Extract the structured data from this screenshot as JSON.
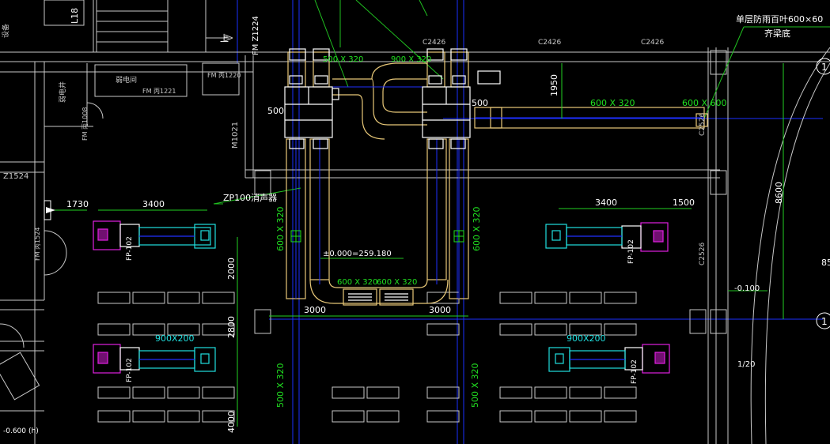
{
  "colors": {
    "background": "#000000",
    "wall": "#c8c8c8",
    "duct": "#e8c878",
    "duct_center": "#2030ff",
    "dim": "#22d022",
    "leader": "#20c020",
    "cyan": "#20e0e0",
    "magenta": "#e020e0",
    "grid_line": "#1a30ff",
    "equip": "#ffffff",
    "text_white": "#ffffff",
    "text_green": "#20e020"
  },
  "labels": {
    "top_note_1": "单层防雨百叶600×60",
    "top_note_2": "齐梁底",
    "axis_1": "1",
    "axis_2": "1",
    "c2426_a": "C2426",
    "c2426_b": "C2426",
    "c2426_c": "C2426",
    "c2526": "C2526",
    "fm_z1224": "FM Z1224",
    "l_18": "L18",
    "up": "上",
    "room_1": "弱电间",
    "fm_1221": "FM 丙1221",
    "fm_1220": "FM 丙1220",
    "fm_1008": "FM 丙1008",
    "m1021": "M1021",
    "z1524": "Z1524",
    "fm_1524": "FM 丙1524",
    "room_2": "弱电井",
    "room_left": "设备",
    "duct_500x320_top": "500 X 320",
    "duct_900x320_top": "900 X 320",
    "duct_600x320_right": "600 X 320",
    "duct_600x600_right": "600 X 600",
    "dim_1950": "1950",
    "dim_500_left": "500",
    "dim_500_right": "500",
    "silencer": "ZP100消声器",
    "dim_1730": "1730",
    "dim_3400_left": "3400",
    "dim_3400_right": "3400",
    "dim_1500": "1500",
    "dim_8600": "8600",
    "dim_85": "85",
    "duct_600x320_vl": "600 X 320",
    "duct_600x320_vr": "600 X 320",
    "elev_main": "±0.000=259.180",
    "duct_600x320_b1": "600 X 320",
    "duct_600x320_b2": "600 X 320",
    "dim_2000": "2000",
    "dim_2800": "2800",
    "dim_3000_l": "3000",
    "dim_3000_r": "3000",
    "elev_right": "-0.100",
    "duct_900x200_l": "900X200",
    "duct_900x200_r": "900X200",
    "slope": "1/20",
    "duct_500x320_vl": "500 X 320",
    "duct_500x320_vr": "500 X 320",
    "dim_4000": "4000",
    "elev_bottom": "-0.600",
    "bottom_tag": "(h)",
    "unit_tag_1": "FP-102",
    "unit_tag_2": "FP-102",
    "unit_tag_3": "FP-102",
    "unit_tag_4": "FP-102"
  }
}
